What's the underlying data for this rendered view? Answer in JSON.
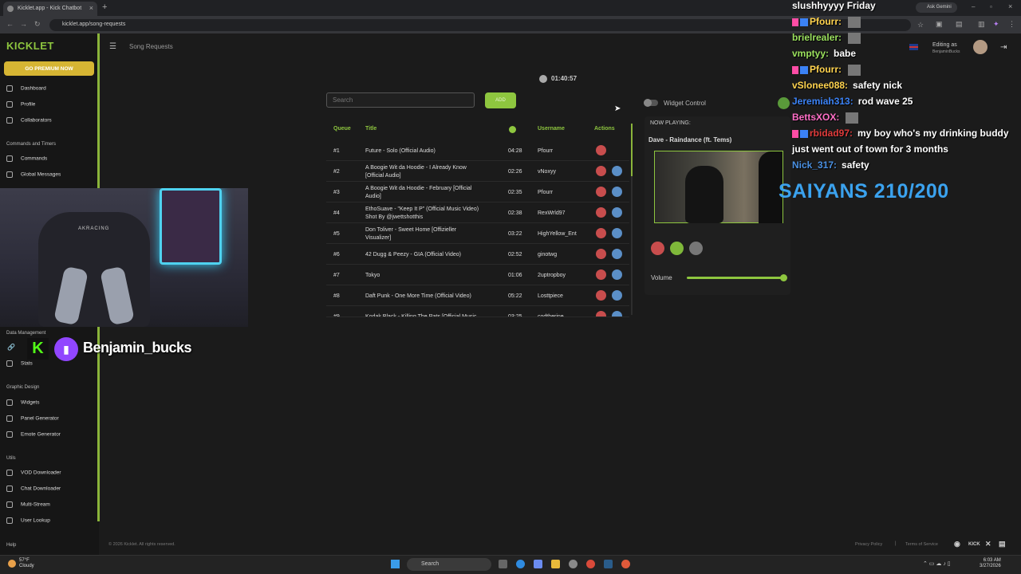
{
  "browser": {
    "tab_title": "Kicklet.app - Kick Chatbot",
    "url": "kicklet.app/song-requests",
    "ask_gemini": "Ask Gemini"
  },
  "sidebar": {
    "logo": "KICKLET",
    "premium_label": "GO PREMIUM NOW",
    "items_top": [
      {
        "label": "Dashboard",
        "icon": "dashboard-icon"
      },
      {
        "label": "Profile",
        "icon": "profile-icon"
      },
      {
        "label": "Collaborators",
        "icon": "collaborators-icon"
      }
    ],
    "section_commands": "Commands and Timers",
    "items_commands": [
      {
        "label": "Commands",
        "icon": "wrench-icon"
      },
      {
        "label": "Global Messages",
        "icon": "chat-icon"
      }
    ],
    "section_data": "Data Management",
    "items_data": [
      {
        "label": "Stats",
        "icon": "stats-icon"
      }
    ],
    "section_graphic": "Graphic Design",
    "items_graphic": [
      {
        "label": "Widgets",
        "icon": "widgets-icon"
      },
      {
        "label": "Panel Generator",
        "icon": "panel-icon"
      },
      {
        "label": "Emote Generator",
        "icon": "emote-icon"
      }
    ],
    "section_utils": "Utils",
    "items_utils": [
      {
        "label": "VOD Downloader",
        "icon": "download-icon"
      },
      {
        "label": "Chat Downloader",
        "icon": "chat-download-icon"
      },
      {
        "label": "Multi-Stream",
        "icon": "multistream-icon"
      },
      {
        "label": "User Lookup",
        "icon": "lookup-icon"
      }
    ],
    "help": "Help"
  },
  "header": {
    "page_title": "Song Requests",
    "editing_as": "Editing as",
    "username": "BenjaminBucks"
  },
  "main": {
    "timer": "01:40:57",
    "search_placeholder": "Search",
    "add_label": "ADD",
    "columns": {
      "queue": "Queue",
      "title": "Title",
      "username": "Username",
      "actions": "Actions"
    },
    "rows": [
      {
        "queue": "#1",
        "title": "Future - Solo (Official Audio)",
        "title2": "",
        "duration": "04:28",
        "user": "Pfourr",
        "up": false
      },
      {
        "queue": "#2",
        "title": "A Boogie Wit da Hoodie - I Already Know",
        "title2": "[Official Audio]",
        "duration": "02:26",
        "user": "vNoxyy",
        "up": true
      },
      {
        "queue": "#3",
        "title": "A Boogie Wit da Hoodie - February [Official",
        "title2": "Audio]",
        "duration": "02:35",
        "user": "Pfourr",
        "up": true
      },
      {
        "queue": "#4",
        "title": "EthoSuave - \"Keep It P\" (Official Music Video)",
        "title2": "Shot By @jwettshotthis",
        "duration": "02:38",
        "user": "RexWrld97",
        "up": true
      },
      {
        "queue": "#5",
        "title": "Don Toliver - Sweet Home [Offizieller",
        "title2": "Visualizer]",
        "duration": "03:22",
        "user": "HighYellow_Ent",
        "up": true
      },
      {
        "queue": "#6",
        "title": "42 Dugg & Peezy - GIA (Official Video)",
        "title2": "",
        "duration": "02:52",
        "user": "ginotwg",
        "up": true
      },
      {
        "queue": "#7",
        "title": "Tokyo",
        "title2": "",
        "duration": "01:06",
        "user": "2uptropboy",
        "up": true
      },
      {
        "queue": "#8",
        "title": "Daft Punk - One More Time (Official Video)",
        "title2": "",
        "duration": "05:22",
        "user": "Losttpiece",
        "up": true
      },
      {
        "queue": "#9",
        "title": "Kodak Black - Killing The Rats [Official Music",
        "title2": "",
        "duration": "03:25",
        "user": "codtherine",
        "up": true
      }
    ],
    "widget_control": "Widget Control",
    "now_playing_label": "NOW PLAYING:",
    "now_playing_title": "Dave - Raindance (ft. Tems)",
    "volume_label": "Volume",
    "volume_level": 0.98
  },
  "footer": {
    "copyright": "© 2026 Kicklet. All rights reserved.",
    "privacy": "Privacy Policy",
    "pipe": "|",
    "terms": "Terms of Service"
  },
  "stream": {
    "streamer": "Benjamin_bucks",
    "chair_brand": "AKRACING",
    "goal": "SAIYANS 210/200",
    "chat": [
      {
        "name": "",
        "color": "#ffffff",
        "msg": "slushhyyyy Friday",
        "badge": false
      },
      {
        "name": "Pfourr:",
        "color": "#ffd34e",
        "msg": "",
        "badge": true
      },
      {
        "name": "brielrealer:",
        "color": "#9be15d",
        "msg": "",
        "badge": false
      },
      {
        "name": "vmptyy:",
        "color": "#9be15d",
        "msg": "babe",
        "badge": false
      },
      {
        "name": "Pfourr:",
        "color": "#ffd34e",
        "msg": "",
        "badge": true
      },
      {
        "name": "vSlonee088:",
        "color": "#ffd34e",
        "msg": "safety nick",
        "badge": false
      },
      {
        "name": "Jeremiah313:",
        "color": "#3b82f6",
        "msg": "rod wave 25",
        "badge": false
      },
      {
        "name": "BettsXOX:",
        "color": "#ff6ec7",
        "msg": "",
        "badge": false
      },
      {
        "name": "rbidad97:",
        "color": "#e03b3b",
        "msg": "my boy who's my drinking buddy",
        "badge": true
      },
      {
        "name": "",
        "color": "#ffffff",
        "msg": "just went out of town for 3 months",
        "badge": false
      },
      {
        "name": "Nick_317:",
        "color": "#4a90e2",
        "msg": "safety",
        "badge": false
      }
    ]
  },
  "taskbar": {
    "weather_temp": "57°F",
    "weather_desc": "Cloudy",
    "search": "Search",
    "time": "6:03 AM",
    "date": "3/27/2026"
  }
}
